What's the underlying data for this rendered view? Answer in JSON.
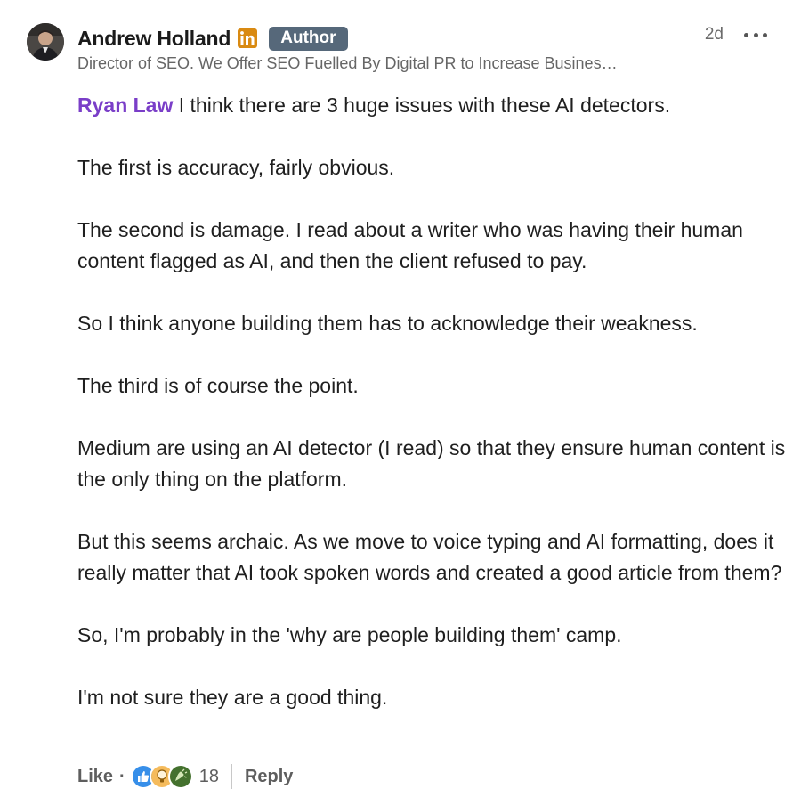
{
  "comment": {
    "author": {
      "name": "Andrew Holland",
      "badge": "Author",
      "headline": "Director of SEO. We Offer SEO Fuelled By Digital PR to Increase Busines…"
    },
    "timestamp": "2d",
    "mention": "Ryan Law",
    "paragraphs": [
      " I think there are 3 huge issues with these AI detectors.",
      "The first is accuracy, fairly obvious.",
      "The second is damage. I read about a writer who was having their human content flagged as AI, and then the client refused to pay.",
      "So I think anyone building them has to acknowledge their weakness.",
      "The third is of course the point.",
      "Medium are using an AI detector (I read) so that they ensure human content is the only thing on the platform.",
      "But this seems archaic. As we move to voice typing and AI formatting, does it really matter that AI took spoken words and created a good article from them?",
      "So, I'm probably in the 'why are people building them' camp.",
      "I'm not sure they are a good thing."
    ],
    "actions": {
      "like_label": "Like",
      "separator": "·",
      "reaction_count": "18",
      "reply_label": "Reply"
    },
    "reactions": [
      "like-icon",
      "insightful-icon",
      "celebrate-icon"
    ],
    "colors": {
      "mention": "#7a3ec8",
      "badge_bg": "#56687a",
      "linkedin_orange": "#d98a12",
      "like_blue": "#378fe9",
      "insight_yellow": "#f5bb5c",
      "celebrate_green": "#44712e"
    }
  }
}
